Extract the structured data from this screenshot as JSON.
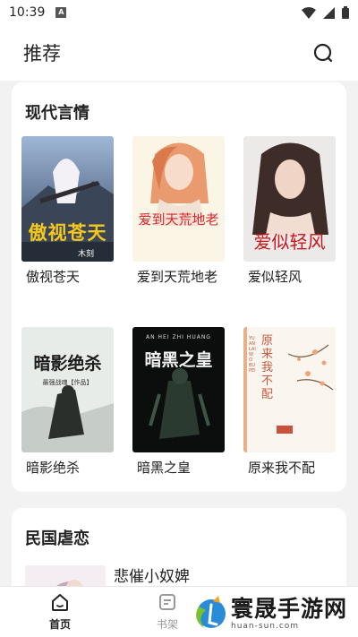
{
  "status_bar": {
    "time": "10:39",
    "notification_badge": "A"
  },
  "header": {
    "title": "推荐"
  },
  "sections": [
    {
      "title": "现代言情",
      "books": [
        {
          "title": "傲视苍天",
          "cover_text": "傲视苍天",
          "cover_author": "木刻"
        },
        {
          "title": "爱到天荒地老",
          "cover_text": "爱到天荒地老"
        },
        {
          "title": "爱似轻风",
          "cover_text": "爱似轻风"
        },
        {
          "title": "暗影绝杀",
          "cover_text": "暗影绝杀",
          "cover_sub": "最强战魂【作品】"
        },
        {
          "title": "暗黑之皇",
          "cover_text": "暗黑之皇",
          "cover_sub": "AN HEI ZHI HUANG"
        },
        {
          "title": "原来我不配",
          "cover_text": "原来我不配",
          "cover_sub": "YUAN LAI WO BU PEI"
        }
      ]
    },
    {
      "title": "民国虐恋",
      "books": [
        {
          "title": "悲催小奴婢"
        }
      ]
    }
  ],
  "tabbar": {
    "tabs": [
      {
        "label": "首页",
        "icon": "home-icon",
        "active": true
      },
      {
        "label": "书架",
        "icon": "bookshelf-icon",
        "active": false
      }
    ]
  },
  "watermark": {
    "name": "寰晟手游网",
    "url": "huan-sun.com"
  },
  "colors": {
    "accent": "#222222",
    "background": "#f2f2f2",
    "card": "#ffffff"
  }
}
